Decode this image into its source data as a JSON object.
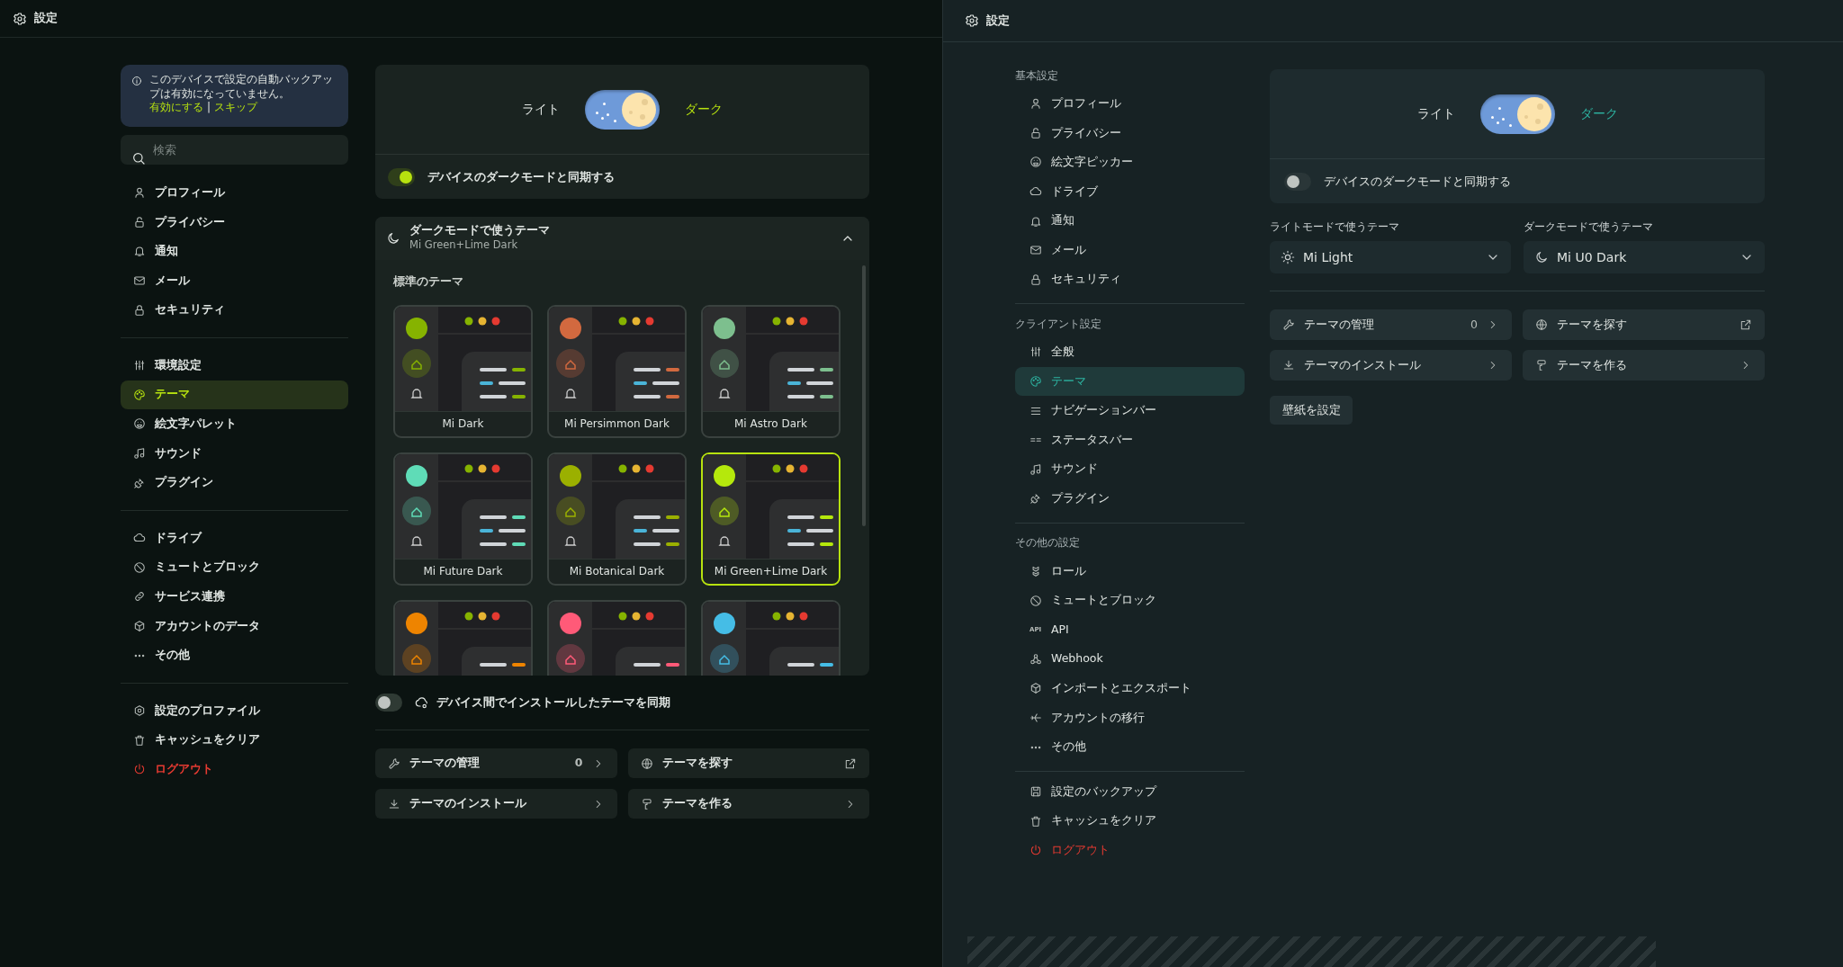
{
  "left_window": {
    "title": "設定",
    "backup_notice": {
      "message": "このデバイスで設定の自動バックアップは有効になっていません。",
      "enable_link": "有効にする",
      "separator": "|",
      "skip_link": "スキップ"
    },
    "search": {
      "placeholder": "検索"
    },
    "nav_groups": [
      {
        "items": [
          {
            "label": "プロフィール",
            "selected": false
          },
          {
            "label": "プライバシー",
            "selected": false
          },
          {
            "label": "通知",
            "selected": false
          },
          {
            "label": "メール",
            "selected": false
          },
          {
            "label": "セキュリティ",
            "selected": false
          }
        ]
      },
      {
        "items": [
          {
            "label": "環境設定",
            "selected": false
          },
          {
            "label": "テーマ",
            "selected": true
          },
          {
            "label": "絵文字パレット",
            "selected": false
          },
          {
            "label": "サウンド",
            "selected": false
          },
          {
            "label": "プラグイン",
            "selected": false
          }
        ]
      },
      {
        "items": [
          {
            "label": "ドライブ",
            "selected": false
          },
          {
            "label": "ミュートとブロック",
            "selected": false
          },
          {
            "label": "サービス連携",
            "selected": false
          },
          {
            "label": "アカウントのデータ",
            "selected": false
          },
          {
            "label": "その他",
            "selected": false
          }
        ]
      },
      {
        "items": [
          {
            "label": "設定のプロファイル",
            "selected": false,
            "danger": false
          },
          {
            "label": "キャッシュをクリア",
            "selected": false,
            "danger": false
          },
          {
            "label": "ログアウト",
            "selected": false,
            "danger": true
          }
        ]
      }
    ],
    "mode_toggle": {
      "light_label": "ライト",
      "dark_label": "ダーク",
      "dark": true
    },
    "sync_dark_mode": {
      "label": "デバイスのダークモードと同期する",
      "on": true
    },
    "dark_theme_panel": {
      "title": "ダークモードで使うテーマ",
      "subtitle": "Mi Green+Lime Dark",
      "expanded": true,
      "section_label": "標準のテーマ",
      "themes": [
        {
          "name": "Mi Dark",
          "selected": false,
          "color": "#86b300"
        },
        {
          "name": "Mi Persimmon Dark",
          "selected": false,
          "color": "#d2693f"
        },
        {
          "name": "Mi Astro Dark",
          "selected": false,
          "color": "#7dbf8e"
        },
        {
          "name": "Mi Future Dark",
          "selected": false,
          "color": "#5fdcb7"
        },
        {
          "name": "Mi Botanical Dark",
          "selected": false,
          "color": "#9bb000"
        },
        {
          "name": "Mi Green+Lime Dark",
          "selected": true,
          "color": "#b5e80c"
        },
        {
          "selected": false,
          "color": "#ee8400"
        },
        {
          "selected": false,
          "color": "#ff5a78"
        },
        {
          "selected": false,
          "color": "#45bde6"
        }
      ]
    },
    "sync_installed": {
      "label": "デバイス間でインストールしたテーマを同期",
      "on": false
    },
    "actions": [
      {
        "label": "テーマの管理",
        "count": "0",
        "kind": "internal"
      },
      {
        "label": "テーマを探す",
        "kind": "external"
      },
      {
        "label": "テーマのインストール",
        "kind": "internal"
      },
      {
        "label": "テーマを作る",
        "kind": "internal"
      }
    ]
  },
  "right_window": {
    "title": "設定",
    "sidebar_sections": [
      {
        "title": "基本設定",
        "items": [
          {
            "label": "プロフィール",
            "selected": false
          },
          {
            "label": "プライバシー",
            "selected": false
          },
          {
            "label": "絵文字ピッカー",
            "selected": false
          },
          {
            "label": "ドライブ",
            "selected": false
          },
          {
            "label": "通知",
            "selected": false
          },
          {
            "label": "メール",
            "selected": false
          },
          {
            "label": "セキュリティ",
            "selected": false
          }
        ]
      },
      {
        "title": "クライアント設定",
        "items": [
          {
            "label": "全般",
            "selected": false
          },
          {
            "label": "テーマ",
            "selected": true
          },
          {
            "label": "ナビゲーションバー",
            "selected": false
          },
          {
            "label": "ステータスバー",
            "selected": false
          },
          {
            "label": "サウンド",
            "selected": false
          },
          {
            "label": "プラグイン",
            "selected": false
          }
        ]
      },
      {
        "title": "その他の設定",
        "items": [
          {
            "label": "ロール",
            "selected": false
          },
          {
            "label": "ミュートとブロック",
            "selected": false
          },
          {
            "label": "API",
            "selected": false,
            "icon_text": "API"
          },
          {
            "label": "Webhook",
            "selected": false
          },
          {
            "label": "インポートとエクスポート",
            "selected": false
          },
          {
            "label": "アカウントの移行",
            "selected": false
          },
          {
            "label": "その他",
            "selected": false
          }
        ]
      },
      {
        "items": [
          {
            "label": "設定のバックアップ",
            "selected": false,
            "danger": false
          },
          {
            "label": "キャッシュをクリア",
            "selected": false,
            "danger": false
          },
          {
            "label": "ログアウト",
            "selected": false,
            "danger": true
          }
        ]
      }
    ],
    "mode_toggle": {
      "light_label": "ライト",
      "dark_label": "ダーク",
      "dark": true
    },
    "sync_dark_mode": {
      "label": "デバイスのダークモードと同期する",
      "on": false
    },
    "theme_selects": [
      {
        "label": "ライトモードで使うテーマ",
        "value": "Mi Light",
        "kind": "light"
      },
      {
        "label": "ダークモードで使うテーマ",
        "value": "Mi U0 Dark",
        "kind": "dark"
      }
    ],
    "actions": [
      {
        "label": "テーマの管理",
        "count": "0",
        "kind": "internal"
      },
      {
        "label": "テーマを探す",
        "kind": "external"
      },
      {
        "label": "テーマのインストール",
        "kind": "internal"
      },
      {
        "label": "テーマを作る",
        "kind": "internal"
      }
    ],
    "wallpaper_button": "壁紙を設定"
  }
}
